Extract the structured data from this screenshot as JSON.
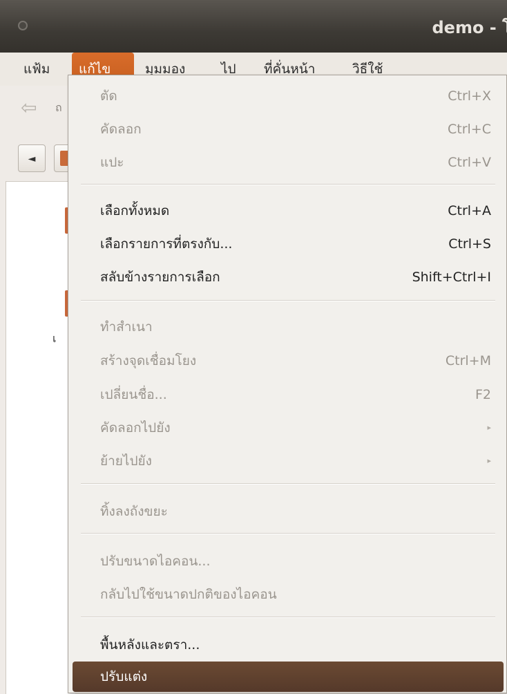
{
  "window": {
    "title": "demo - โ"
  },
  "menubar": {
    "items": [
      "แฟ้ม",
      "แก้ไข",
      "มุมมอง",
      "ไป",
      "ที่คั่นหน้า",
      "วิธีใช้"
    ],
    "active_index": 1
  },
  "toolbar": {
    "back_label": "ถ",
    "path_arrow": "◄"
  },
  "files": {
    "partial_label": "เ"
  },
  "edit_menu": {
    "items": [
      {
        "label": "ตัด",
        "shortcut": "Ctrl+X",
        "enabled": false
      },
      {
        "label": "คัดลอก",
        "shortcut": "Ctrl+C",
        "enabled": false
      },
      {
        "label": "แปะ",
        "shortcut": "Ctrl+V",
        "enabled": false
      },
      {
        "label": "เลือกทั้งหมด",
        "shortcut": "Ctrl+A",
        "enabled": true
      },
      {
        "label": "เลือกรายการที่ตรงกับ...",
        "shortcut": "Ctrl+S",
        "enabled": true
      },
      {
        "label": "สลับข้างรายการเลือก",
        "shortcut": "Shift+Ctrl+I",
        "enabled": true
      },
      {
        "label": "ทำสำเนา",
        "shortcut": "",
        "enabled": false
      },
      {
        "label": "สร้างจุดเชื่อมโยง",
        "shortcut": "Ctrl+M",
        "enabled": false
      },
      {
        "label": "เปลี่ยนชื่อ...",
        "shortcut": "F2",
        "enabled": false
      },
      {
        "label": "คัดลอกไปยัง",
        "shortcut": "▸",
        "enabled": false
      },
      {
        "label": "ย้ายไปยัง",
        "shortcut": "▸",
        "enabled": false
      },
      {
        "label": "ทิ้งลงถังขยะ",
        "shortcut": "",
        "enabled": false
      },
      {
        "label": "ปรับขนาดไอคอน...",
        "shortcut": "",
        "enabled": false
      },
      {
        "label": "กลับไปใช้ขนาดปกติของไอคอน",
        "shortcut": "",
        "enabled": false
      },
      {
        "label": "พื้นหลังและตรา...",
        "shortcut": "",
        "enabled": true
      },
      {
        "label": "ปรับแต่ง",
        "shortcut": "",
        "enabled": true,
        "highlighted": true
      }
    ]
  },
  "colors": {
    "menubar_active": "#d06526",
    "highlight": "#5f4130",
    "disabled_text": "#9a958e"
  }
}
